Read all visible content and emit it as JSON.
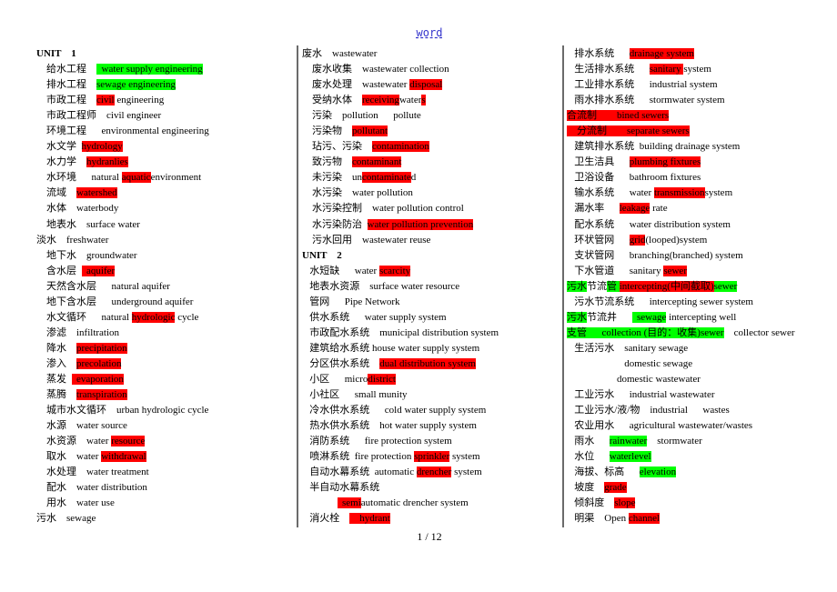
{
  "header": {
    "link_text": "word"
  },
  "footer": {
    "page_indicator": "1 / 12"
  },
  "highlight_colors": {
    "red": "#ff0000",
    "green": "#00ff00"
  },
  "columns": [
    {
      "lines": [
        {
          "bold": true,
          "segments": [
            {
              "t": "UNIT    1"
            }
          ]
        },
        {
          "segments": [
            {
              "t": "    给水工程    "
            },
            {
              "t": "  water supply engineering",
              "h": "green"
            }
          ]
        },
        {
          "segments": [
            {
              "t": "    排水工程    "
            },
            {
              "t": "sewage engineering",
              "h": "green"
            }
          ]
        },
        {
          "segments": [
            {
              "t": "    市政工程    "
            },
            {
              "t": "civil",
              "h": "red"
            },
            {
              "t": " engineering"
            }
          ]
        },
        {
          "segments": [
            {
              "t": "    市政工程师    civil engineer"
            }
          ]
        },
        {
          "segments": [
            {
              "t": "    环境工程      environmental engineering"
            }
          ]
        },
        {
          "segments": [
            {
              "t": "    水文学  "
            },
            {
              "t": "hydrology",
              "h": "red"
            }
          ]
        },
        {
          "segments": [
            {
              "t": "    水力学    "
            },
            {
              "t": "hydranlies",
              "h": "red"
            }
          ]
        },
        {
          "segments": [
            {
              "t": "    水环境      natural "
            },
            {
              "t": "aquatic",
              "h": "red"
            },
            {
              "t": "environment"
            }
          ]
        },
        {
          "segments": [
            {
              "t": "    流域    "
            },
            {
              "t": "watershed",
              "h": "red"
            }
          ]
        },
        {
          "segments": [
            {
              "t": "    水体    waterbody"
            }
          ]
        },
        {
          "segments": [
            {
              "t": "    地表水    surface water"
            }
          ]
        },
        {
          "segments": [
            {
              "t": "淡水    freshwater"
            }
          ]
        },
        {
          "segments": [
            {
              "t": "    地下水    groundwater"
            }
          ]
        },
        {
          "segments": [
            {
              "t": "    含水层  "
            },
            {
              "t": "  aquifer",
              "h": "red"
            }
          ]
        },
        {
          "segments": [
            {
              "t": "    天然含水层      natural aquifer"
            }
          ]
        },
        {
          "segments": [
            {
              "t": "    地下含水层      underground aquifer"
            }
          ]
        },
        {
          "segments": [
            {
              "t": "    水文循环      natural "
            },
            {
              "t": "hydrologic",
              "h": "red"
            },
            {
              "t": " cycle"
            }
          ]
        },
        {
          "segments": [
            {
              "t": "    渗滤    infiltration"
            }
          ]
        },
        {
          "segments": [
            {
              "t": "    降水    "
            },
            {
              "t": "precipitation",
              "h": "red"
            }
          ]
        },
        {
          "segments": [
            {
              "t": "    渗入    "
            },
            {
              "t": "precolation",
              "h": "red"
            }
          ]
        },
        {
          "segments": [
            {
              "t": "    蒸发  "
            },
            {
              "t": "  evaporation",
              "h": "red"
            }
          ]
        },
        {
          "segments": [
            {
              "t": "    蒸腾    "
            },
            {
              "t": "transpiration",
              "h": "red"
            }
          ]
        },
        {
          "segments": [
            {
              "t": "    城市水文循环    urban hydrologic cycle"
            }
          ]
        },
        {
          "segments": [
            {
              "t": "    水源    water source"
            }
          ]
        },
        {
          "segments": [
            {
              "t": "    水资源    water "
            },
            {
              "t": "resource",
              "h": "red"
            }
          ]
        },
        {
          "segments": [
            {
              "t": "    取水    water "
            },
            {
              "t": "withdrawal",
              "h": "red"
            }
          ]
        },
        {
          "segments": [
            {
              "t": "    水处理    water treatment"
            }
          ]
        },
        {
          "segments": [
            {
              "t": "    配水    water distribution"
            }
          ]
        },
        {
          "segments": [
            {
              "t": "    用水    water use"
            }
          ]
        },
        {
          "segments": [
            {
              "t": "污水    sewage"
            }
          ]
        }
      ]
    },
    {
      "lines": [
        {
          "segments": [
            {
              "t": "废水    wastewater"
            }
          ]
        },
        {
          "segments": [
            {
              "t": "    废水收集    wastewater collection"
            }
          ]
        },
        {
          "segments": [
            {
              "t": "    废水处理    wastewater "
            },
            {
              "t": "disposal",
              "h": "red"
            }
          ]
        },
        {
          "segments": [
            {
              "t": "    受纳水体    "
            },
            {
              "t": "receiving",
              "h": "red"
            },
            {
              "t": "water"
            },
            {
              "t": "s",
              "h": "red"
            }
          ]
        },
        {
          "segments": [
            {
              "t": "    污染    pollution      pollute"
            }
          ]
        },
        {
          "segments": [
            {
              "t": "    污染物    "
            },
            {
              "t": "pollutant",
              "h": "red"
            }
          ]
        },
        {
          "segments": [
            {
              "t": "    玷污、污染    "
            },
            {
              "t": "contamination",
              "h": "red"
            }
          ]
        },
        {
          "segments": [
            {
              "t": "    致污物    "
            },
            {
              "t": "contaminant",
              "h": "red"
            }
          ]
        },
        {
          "segments": [
            {
              "t": "    未污染    un"
            },
            {
              "t": "contaminate",
              "h": "red"
            },
            {
              "t": "d"
            }
          ]
        },
        {
          "segments": [
            {
              "t": "    水污染    water pollution"
            }
          ]
        },
        {
          "segments": [
            {
              "t": "    水污染控制    water pollution control"
            }
          ]
        },
        {
          "segments": [
            {
              "t": "    水污染防治  "
            },
            {
              "t": "water pollution prevention",
              "h": "red"
            }
          ]
        },
        {
          "segments": [
            {
              "t": "    污水回用    wastewater reuse"
            }
          ]
        },
        {
          "bold": true,
          "segments": [
            {
              "t": "UNIT    2"
            }
          ]
        },
        {
          "segments": [
            {
              "t": "   水短缺      water "
            },
            {
              "t": "scarcity",
              "h": "red"
            }
          ]
        },
        {
          "segments": [
            {
              "t": "   地表水资源    surface water resource"
            }
          ]
        },
        {
          "segments": [
            {
              "t": "   管网      Pipe Network"
            }
          ]
        },
        {
          "segments": [
            {
              "t": "   供水系统      water supply system"
            }
          ]
        },
        {
          "segments": [
            {
              "t": "   市政配水系统    municipal distribution system"
            }
          ]
        },
        {
          "segments": [
            {
              "t": "   建筑给水系统 house water supply system"
            }
          ]
        },
        {
          "segments": [
            {
              "t": "   分区供水系统    "
            },
            {
              "t": "dual distribution system",
              "h": "red"
            }
          ]
        },
        {
          "segments": [
            {
              "t": "   小区      micro"
            },
            {
              "t": "district",
              "h": "red"
            }
          ]
        },
        {
          "segments": [
            {
              "t": "   小社区      small munity"
            }
          ]
        },
        {
          "segments": [
            {
              "t": "   冷水供水系统      cold water supply system"
            }
          ]
        },
        {
          "segments": [
            {
              "t": "   热水供水系统    hot water supply system"
            }
          ]
        },
        {
          "segments": [
            {
              "t": "   消防系统      fire protection system"
            }
          ]
        },
        {
          "segments": [
            {
              "t": "   喷淋系统  fire protection "
            },
            {
              "t": "sprinkler",
              "h": "red"
            },
            {
              "t": " system"
            }
          ]
        },
        {
          "segments": [
            {
              "t": "   自动水幕系统  automatic "
            },
            {
              "t": "drencher",
              "h": "red"
            },
            {
              "t": " system"
            }
          ]
        },
        {
          "segments": [
            {
              "t": "   半自动水幕系统"
            }
          ]
        },
        {
          "segments": [
            {
              "t": "              "
            },
            {
              "t": "  semi",
              "h": "red"
            },
            {
              "t": "automatic drencher system"
            }
          ]
        },
        {
          "segments": [
            {
              "t": "   消火栓    "
            },
            {
              "t": "    hydrant",
              "h": "red"
            }
          ]
        }
      ]
    },
    {
      "lines": [
        {
          "segments": [
            {
              "t": "   排水系统      "
            },
            {
              "t": "drainage system",
              "h": "red"
            }
          ]
        },
        {
          "segments": [
            {
              "t": "   生活排水系统      "
            },
            {
              "t": "sanitary ",
              "h": "red"
            },
            {
              "t": "system"
            }
          ]
        },
        {
          "segments": [
            {
              "t": "   工业排水系统      industrial system"
            }
          ]
        },
        {
          "segments": [
            {
              "t": "   雨水排水系统      stormwater system"
            }
          ]
        },
        {
          "segments": [
            {
              "t": "合流制        bined sewers",
              "h": "red"
            }
          ]
        },
        {
          "segments": [
            {
              "t": "    分流制        separate sewers",
              "h": "red"
            }
          ]
        },
        {
          "segments": [
            {
              "t": "   建筑排水系统  building drainage system"
            }
          ]
        },
        {
          "segments": [
            {
              "t": "   卫生洁具      "
            },
            {
              "t": "plumbing fixtures",
              "h": "red"
            }
          ]
        },
        {
          "segments": [
            {
              "t": "   卫浴设备      bathroom fixtures"
            }
          ]
        },
        {
          "segments": [
            {
              "t": "   输水系统      water "
            },
            {
              "t": "transmission",
              "h": "red"
            },
            {
              "t": "system"
            }
          ]
        },
        {
          "segments": [
            {
              "t": "   漏水率      "
            },
            {
              "t": "leakage",
              "h": "red"
            },
            {
              "t": " rate"
            }
          ]
        },
        {
          "segments": [
            {
              "t": "   配水系统      water distribution system"
            }
          ]
        },
        {
          "segments": [
            {
              "t": "   环状管网      "
            },
            {
              "t": "grid",
              "h": "red"
            },
            {
              "t": "(looped)system"
            }
          ]
        },
        {
          "segments": [
            {
              "t": "   支状管网      branching(branched) system"
            }
          ]
        },
        {
          "segments": [
            {
              "t": "   下水管道      sanitary "
            },
            {
              "t": "sewer",
              "h": "red"
            }
          ]
        },
        {
          "segments": [
            {
              "t": "污水",
              "h": "green"
            },
            {
              "t": "节流"
            },
            {
              "t": "管 ",
              "h": "green"
            },
            {
              "t": "intercepting(中间截取)",
              "h": "red"
            },
            {
              "t": "sewer",
              "h": "green"
            }
          ]
        },
        {
          "segments": [
            {
              "t": "   污水节流系统      intercepting sewer system"
            }
          ]
        },
        {
          "segments": [
            {
              "t": "污水",
              "h": "green"
            },
            {
              "t": "节流井      "
            },
            {
              "t": "  sewage",
              "h": "green"
            },
            {
              "t": " intercepting well"
            }
          ]
        },
        {
          "segments": [
            {
              "t": "支管      collection (目的：收集)sewer",
              "h": "green"
            },
            {
              "t": "    collector sewer"
            }
          ]
        },
        {
          "segments": [
            {
              "t": "   生活污水    sanitary sewage"
            }
          ]
        },
        {
          "segments": [
            {
              "t": "                       domestic sewage"
            }
          ]
        },
        {
          "segments": [
            {
              "t": "                    domestic wastewater"
            }
          ]
        },
        {
          "segments": [
            {
              "t": "   工业污水      industrial wastewater"
            }
          ]
        },
        {
          "segments": [
            {
              "t": "   工业污水/液/物    industrial      wastes"
            }
          ]
        },
        {
          "segments": [
            {
              "t": "   农业用水      agricultural wastewater/wastes"
            }
          ]
        },
        {
          "segments": [
            {
              "t": "   雨水      "
            },
            {
              "t": "rainwater",
              "h": "green"
            },
            {
              "t": "    stormwater"
            }
          ]
        },
        {
          "segments": [
            {
              "t": "   水位      "
            },
            {
              "t": "waterlevel",
              "h": "green"
            }
          ]
        },
        {
          "segments": [
            {
              "t": "   海拔、标高      "
            },
            {
              "t": "elevation",
              "h": "green"
            }
          ]
        },
        {
          "segments": [
            {
              "t": "   坡度    "
            },
            {
              "t": "grade",
              "h": "red"
            }
          ]
        },
        {
          "segments": [
            {
              "t": "   倾斜度    "
            },
            {
              "t": "slope",
              "h": "red"
            }
          ]
        },
        {
          "segments": [
            {
              "t": "   明渠    Open "
            },
            {
              "t": "channel",
              "h": "red"
            }
          ]
        }
      ]
    }
  ]
}
